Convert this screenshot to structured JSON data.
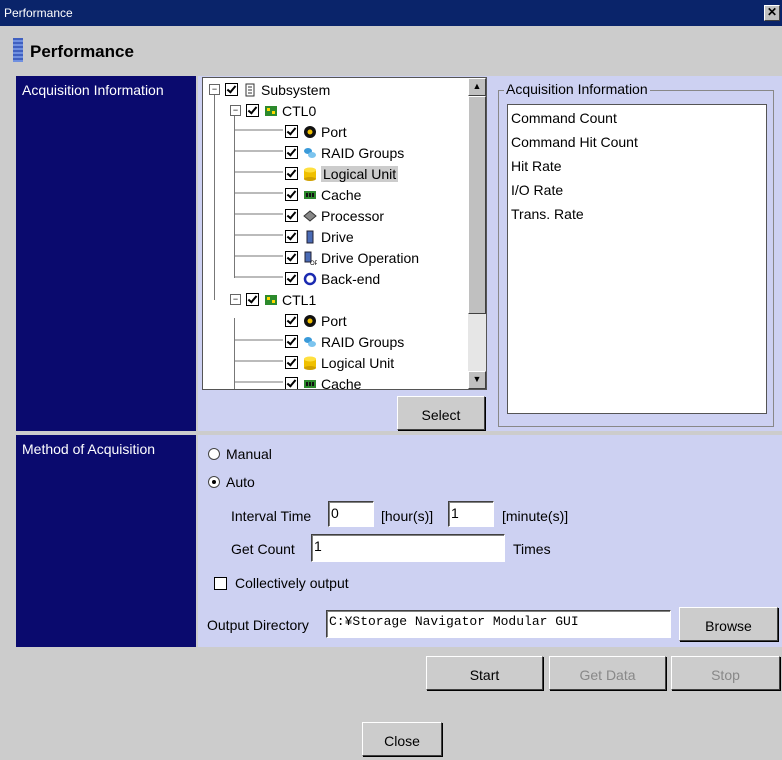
{
  "window": {
    "title": "Performance",
    "close_glyph": "✕"
  },
  "header": {
    "title": "Performance",
    "icon": "performance-logo-icon"
  },
  "acquisition_info": {
    "label": "Acquisition Information",
    "group_title": "Acquisition Information",
    "select_button": "Select",
    "items": [
      "Command Count",
      "Command Hit Count",
      "Hit Rate",
      "I/O Rate",
      "Trans. Rate"
    ]
  },
  "tree": {
    "rows": [
      {
        "label": "Subsystem",
        "icon": "subsystem-icon",
        "expander": "−"
      },
      {
        "label": "CTL0",
        "icon": "controller-icon",
        "expander": "−"
      },
      {
        "label": "Port",
        "icon": "port-icon"
      },
      {
        "label": "RAID Groups",
        "icon": "raid-groups-icon"
      },
      {
        "label": "Logical Unit",
        "icon": "logical-unit-icon",
        "selected": true
      },
      {
        "label": "Cache",
        "icon": "cache-icon"
      },
      {
        "label": "Processor",
        "icon": "processor-icon"
      },
      {
        "label": "Drive",
        "icon": "drive-icon"
      },
      {
        "label": "Drive Operation",
        "icon": "drive-operation-icon"
      },
      {
        "label": "Back-end",
        "icon": "back-end-icon"
      },
      {
        "label": "CTL1",
        "icon": "controller-icon",
        "expander": "−"
      },
      {
        "label": "Port",
        "icon": "port-icon"
      },
      {
        "label": "RAID Groups",
        "icon": "raid-groups-icon"
      },
      {
        "label": "Logical Unit",
        "icon": "logical-unit-icon"
      },
      {
        "label": "Cache",
        "icon": "cache-icon"
      }
    ]
  },
  "method": {
    "label": "Method of Acquisition",
    "manual_label": "Manual",
    "auto_label": "Auto",
    "selected": "Auto",
    "interval_label": "Interval Time",
    "interval_hours": "0",
    "hours_unit": "[hour(s)]",
    "interval_minutes": "1",
    "minutes_unit": "[minute(s)]",
    "get_count_label": "Get Count",
    "get_count": "1",
    "times_label": "Times",
    "collectively_label": "Collectively output",
    "collectively_checked": false,
    "output_dir_label": "Output Directory",
    "output_dir": "C:¥Storage Navigator Modular GUI",
    "browse_button": "Browse"
  },
  "actions": {
    "start": "Start",
    "get_data": "Get Data",
    "stop": "Stop",
    "close": "Close"
  },
  "colors": {
    "section_bg": "#0a0a6e",
    "panel_bg": "#cdd1f2",
    "titlebar": "#0a246a"
  }
}
